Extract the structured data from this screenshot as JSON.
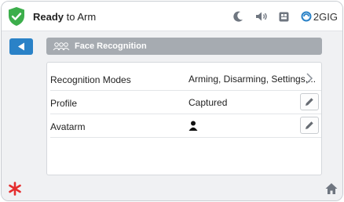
{
  "status": {
    "prefix": "Ready",
    "suffix": " to Arm",
    "icons": [
      "moon-icon",
      "volume-icon",
      "network-icon"
    ],
    "brand": "2GIG"
  },
  "page": {
    "title": "Face Recognition",
    "title_icon": "face-group-icon"
  },
  "rows": [
    {
      "label": "Recognition Modes",
      "value": "Arming, Disarming, Settings,...",
      "action": "chevron"
    },
    {
      "label": "Profile",
      "value": "Captured",
      "action": "edit"
    },
    {
      "label": "Avatarm",
      "value": "",
      "value_icon": "person-icon",
      "action": "edit"
    }
  ],
  "colors": {
    "accent": "#2a82c7",
    "shield": "#3cae4b",
    "emergency": "#e52d2d",
    "titlebar": "#a6abb1"
  }
}
